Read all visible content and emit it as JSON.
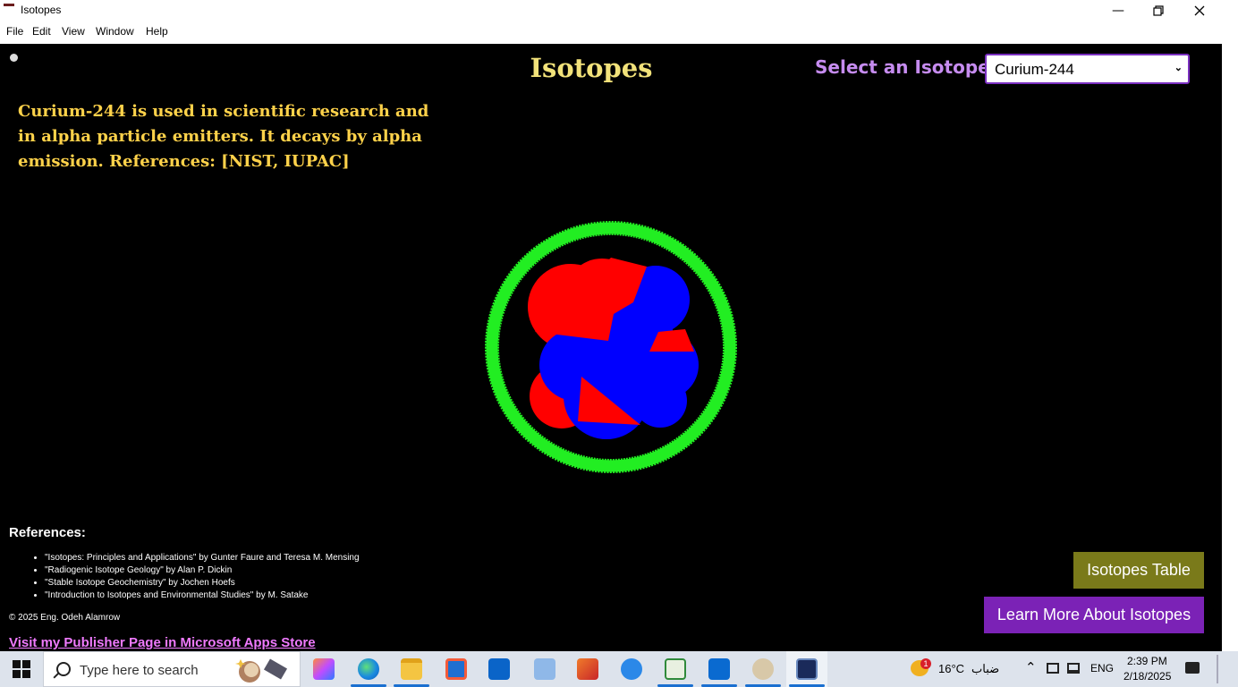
{
  "window": {
    "title": "Isotopes"
  },
  "menu": [
    "File",
    "Edit",
    "View",
    "Window",
    "Help"
  ],
  "page": {
    "heading": "Isotopes",
    "select_label": "Select an Isotope:",
    "selected_isotope": "Curium-244",
    "description": "Curium-244 is used in scientific research and in alpha particle emitters. It decays by alpha emission. References: [NIST, IUPAC]",
    "references_title": "References:",
    "references": [
      "\"Isotopes: Principles and Applications\" by Gunter Faure and Teresa M. Mensing",
      "\"Radiogenic Isotope Geology\" by Alan P. Dickin",
      "\"Stable Isotope Geochemistry\" by Jochen Hoefs",
      "\"Introduction to Isotopes and Environmental Studies\" by M. Satake"
    ],
    "copyright": "© 2025 Eng. Odeh Alamrow",
    "publisher_link": "Visit my Publisher Page in Microsoft Apps Store",
    "isotopes_table_button": "Isotopes Table",
    "learn_more_button": "Learn More About Isotopes"
  },
  "colors": {
    "heading": "#f2e27a",
    "select_label": "#c68cf0",
    "description": "#ffd24a",
    "ring": "#22ee22",
    "proton": "#ff0000",
    "neutron": "#0000ff",
    "table_button": "#7a7a1a",
    "learn_button": "#7b22b6"
  },
  "taskbar": {
    "search_placeholder": "Type here to search",
    "weather_temp": "16°C",
    "weather_desc": "ضباب",
    "weather_badge": "1",
    "language": "ENG",
    "time": "2:39 PM",
    "date": "2/18/2025"
  }
}
